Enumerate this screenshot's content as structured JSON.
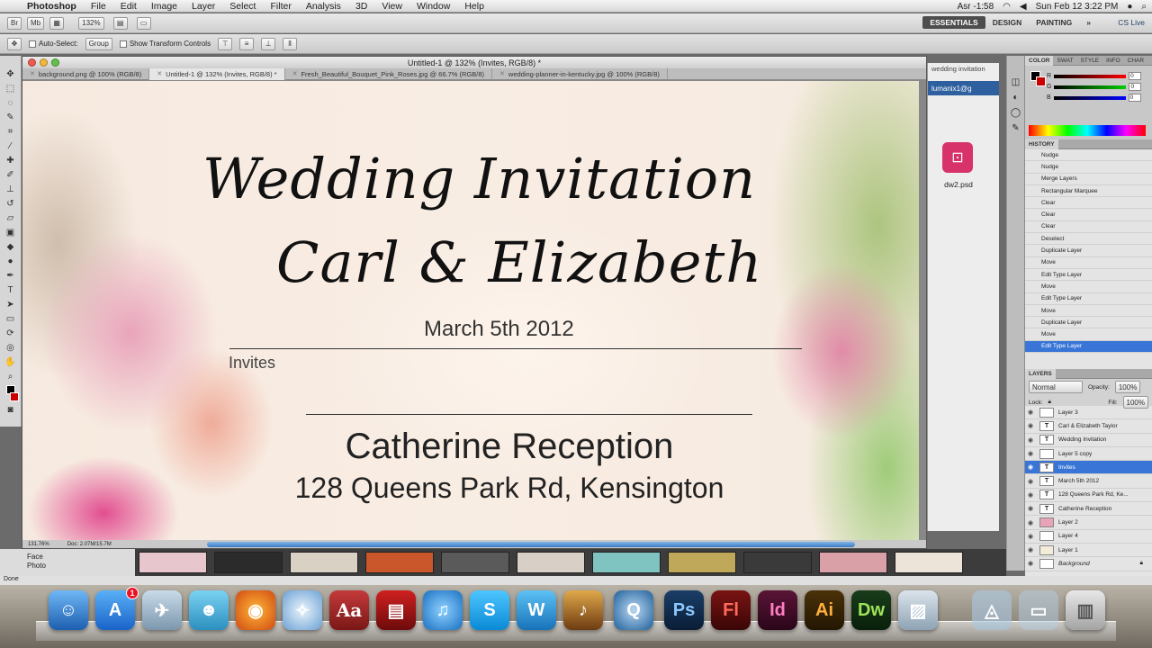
{
  "menubar": {
    "app_name": "Photoshop",
    "menus": [
      "File",
      "Edit",
      "Image",
      "Layer",
      "Select",
      "Filter",
      "Analysis",
      "3D",
      "View",
      "Window",
      "Help"
    ],
    "status_time_left": "Asr -1:58",
    "clock": "Sun Feb 12  3:22 PM",
    "search_label": "CS Live"
  },
  "appbar": {
    "zoom": "132%",
    "workspaces": [
      "ESSENTIALS",
      "DESIGN",
      "PAINTING"
    ]
  },
  "options": {
    "auto_select": "Auto-Select:",
    "group": "Group",
    "transform": "Show Transform Controls"
  },
  "document": {
    "title": "Untitled-1 @ 132% (Invites, RGB/8) *",
    "tabs": [
      {
        "label": "background.png @ 100% (RGB/8)"
      },
      {
        "label": "Untitled-1 @ 132% (Invites, RGB/8) *"
      },
      {
        "label": "Fresh_Beautiful_Bouquet_Pink_Roses.jpg @ 66.7% (RGB/8)"
      },
      {
        "label": "wedding-planner-in-kentucky.jpg @ 100% (RGB/8)"
      }
    ],
    "zoom_status": "131.76%",
    "doc_size": "Doc: 2.07M/15.7M"
  },
  "invitation": {
    "title_line1": "Wedding Invitation",
    "title_line2": "Carl & Elizabeth",
    "date": "March 5th 2012",
    "invites": "Invites",
    "venue": "Catherine Reception",
    "address": "128 Queens Park Rd, Kensington"
  },
  "background_window": {
    "title": "wedding invitation",
    "selected": "lumanix1@g",
    "file_name": "dw2.psd"
  },
  "color_panel": {
    "tabs": [
      "COLOR",
      "SWAT",
      "STYLE",
      "INFO",
      "CHAR"
    ],
    "r": "0",
    "g": "0",
    "b": "0",
    "r_label": "R",
    "g_label": "G",
    "b_label": "B"
  },
  "history": {
    "header": "HISTORY",
    "items": [
      "Nudge",
      "Nudge",
      "Merge Layers",
      "Rectangular Marquee",
      "Clear",
      "Clear",
      "Clear",
      "Deselect",
      "Duplicate Layer",
      "Move",
      "Edit Type Layer",
      "Move",
      "Edit Type Layer",
      "Move",
      "Duplicate Layer",
      "Move",
      "Edit Type Layer"
    ]
  },
  "layers": {
    "header": "LAYERS",
    "blend_mode": "Normal",
    "opacity_label": "Opacity:",
    "opacity": "100%",
    "lock_label": "Lock:",
    "fill_label": "Fill:",
    "fill": "100%",
    "items": [
      {
        "name": "Layer 3",
        "type": "image"
      },
      {
        "name": "Carl & Elizabeth Taylor",
        "type": "text"
      },
      {
        "name": "Wedding Invitation",
        "type": "text"
      },
      {
        "name": "Layer 5 copy",
        "type": "image"
      },
      {
        "name": "Invites",
        "type": "text"
      },
      {
        "name": "March 5th 2012",
        "type": "text"
      },
      {
        "name": "128 Queens Park Rd, Ke...",
        "type": "text"
      },
      {
        "name": "Catherine Reception",
        "type": "text"
      },
      {
        "name": "Layer 2",
        "type": "image"
      },
      {
        "name": "Layer 4",
        "type": "image"
      },
      {
        "name": "Layer 1",
        "type": "image"
      },
      {
        "name": "Background",
        "type": "image"
      }
    ]
  },
  "bridge": {
    "side_items": [
      "Face",
      "Photo"
    ]
  },
  "status": "Done",
  "dock": {
    "items": [
      "Finder",
      "App Store",
      "Preview",
      "iChat",
      "Firefox",
      "Safari",
      "Dictionary",
      "Presenter",
      "iTunes",
      "Skype",
      "Pages",
      "GarageBand",
      "QuickTime",
      "Ps",
      "Fl",
      "Id",
      "Ai",
      "Dw",
      "iPhoto",
      "Applications",
      "Trash"
    ],
    "ps": "Ps",
    "fl": "Fl",
    "id": "Id",
    "ai": "Ai",
    "dw": "Dw",
    "app_store_badge": "1"
  }
}
